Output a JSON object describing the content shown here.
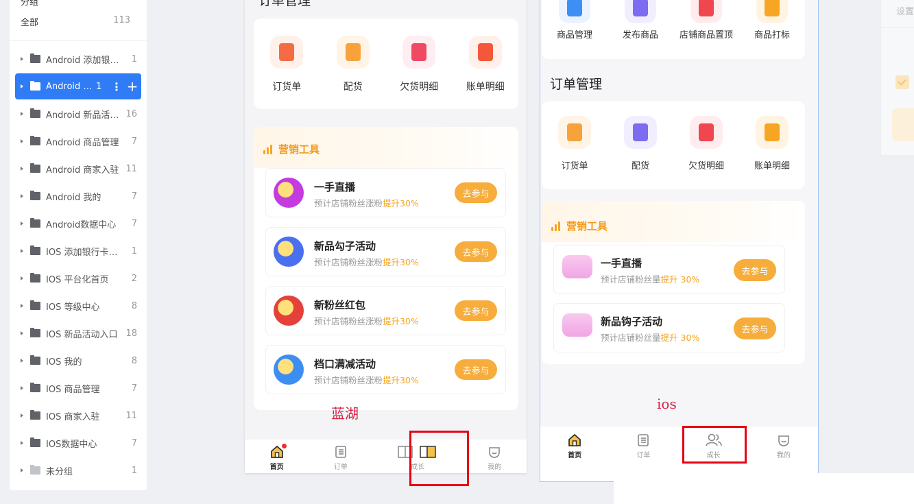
{
  "sidebar": {
    "header_cut": "分组",
    "all": {
      "label": "全部",
      "count": "113"
    },
    "items": [
      {
        "label": "Android 添加银行…",
        "count": "1"
      },
      {
        "label": "Android …",
        "count": "1",
        "active": true
      },
      {
        "label": "Android 新品活…",
        "count": "16"
      },
      {
        "label": "Android 商品管理",
        "count": "7"
      },
      {
        "label": "Android 商家入驻",
        "count": "11"
      },
      {
        "label": "Android 我的",
        "count": "7"
      },
      {
        "label": "Android数据中心",
        "count": "7"
      },
      {
        "label": "IOS 添加银行卡…",
        "count": "1"
      },
      {
        "label": "IOS 平台化首页",
        "count": "2"
      },
      {
        "label": "IOS 等级中心",
        "count": "8"
      },
      {
        "label": "IOS 新品活动入口",
        "count": "18"
      },
      {
        "label": "IOS 我的",
        "count": "8"
      },
      {
        "label": "IOS 商品管理",
        "count": "7"
      },
      {
        "label": "IOS 商家入驻",
        "count": "11"
      },
      {
        "label": "IOS数据中心",
        "count": "7"
      },
      {
        "label": "未分组",
        "count": "1"
      }
    ],
    "more_glyph": "⋮",
    "add_glyph": "+"
  },
  "phone_lanhu": {
    "title": "订单管理",
    "order_items": [
      {
        "label": "订货单",
        "color": "#f46b45",
        "bg": "#fff1e9"
      },
      {
        "label": "配货",
        "color": "#f7a23b",
        "bg": "#fff4e5"
      },
      {
        "label": "欠货明细",
        "color": "#ef4964",
        "bg": "#ffeef1"
      },
      {
        "label": "账单明细",
        "color": "#f4583a",
        "bg": "#fff0ea"
      }
    ],
    "marketing_title": "营销工具",
    "activities": [
      {
        "name": "一手直播",
        "desc": "预计店铺粉丝涨粉",
        "highlight": "提升30%",
        "button": "去参与",
        "color": "#c43be0"
      },
      {
        "name": "新品勾子活动",
        "desc": "预计店铺粉丝涨粉",
        "highlight": "提升30%",
        "button": "去参与",
        "color": "#4a6ff0"
      },
      {
        "name": "新粉丝红包",
        "desc": "预计店铺粉丝涨粉",
        "highlight": "提升30%",
        "button": "去参与",
        "color": "#e5403a"
      },
      {
        "name": "档口满减活动",
        "desc": "预计店铺粉丝涨粉",
        "highlight": "提升30%",
        "button": "去参与",
        "color": "#3d8ef2"
      }
    ],
    "tabs": [
      {
        "label": "首页",
        "icon": "home-icon",
        "active": true
      },
      {
        "label": "订单",
        "icon": "order-icon"
      },
      {
        "label": "成长",
        "icon": "book-icon"
      },
      {
        "label": "我的",
        "icon": "face-icon"
      }
    ]
  },
  "phone_ios": {
    "product_items": [
      {
        "label": "商品管理",
        "color": "#3c8ff5",
        "bg": "#eaf3ff"
      },
      {
        "label": "发布商品",
        "color": "#7d6bf2",
        "bg": "#f0eeff"
      },
      {
        "label": "店铺商品置顶",
        "color": "#ef4650",
        "bg": "#ffecee"
      },
      {
        "label": "商品打标",
        "color": "#f6a623",
        "bg": "#fff4e2"
      }
    ],
    "order_title": "订单管理",
    "order_items": [
      {
        "label": "订货单",
        "color": "#f7a23b",
        "bg": "#fff4e5"
      },
      {
        "label": "配货",
        "color": "#7d6bf2",
        "bg": "#f0eeff"
      },
      {
        "label": "欠货明细",
        "color": "#ef4650",
        "bg": "#ffecee"
      },
      {
        "label": "账单明细",
        "color": "#f6a623",
        "bg": "#fff4e2"
      }
    ],
    "marketing_title": "营销工具",
    "activities": [
      {
        "name": "一手直播",
        "desc": "预计店铺粉丝量",
        "highlight": "提升 30%",
        "button": "去参与"
      },
      {
        "name": "新品钩子活动",
        "desc": "预计店铺粉丝量",
        "highlight": "提升 30%",
        "button": "去参与"
      }
    ],
    "tabs": [
      {
        "label": "首页",
        "icon": "home-icon",
        "active": true
      },
      {
        "label": "订单",
        "icon": "order-icon"
      },
      {
        "label": "成长",
        "icon": "people-icon"
      },
      {
        "label": "我的",
        "icon": "face-icon"
      }
    ]
  },
  "annotations": {
    "lanhu": "蓝湖",
    "ios": "ios"
  },
  "right_panel": {
    "text": "设置"
  },
  "colors": {
    "accent": "#2f7cf6",
    "orange": "#f6ad3c",
    "annotation_red": "#e60012"
  }
}
